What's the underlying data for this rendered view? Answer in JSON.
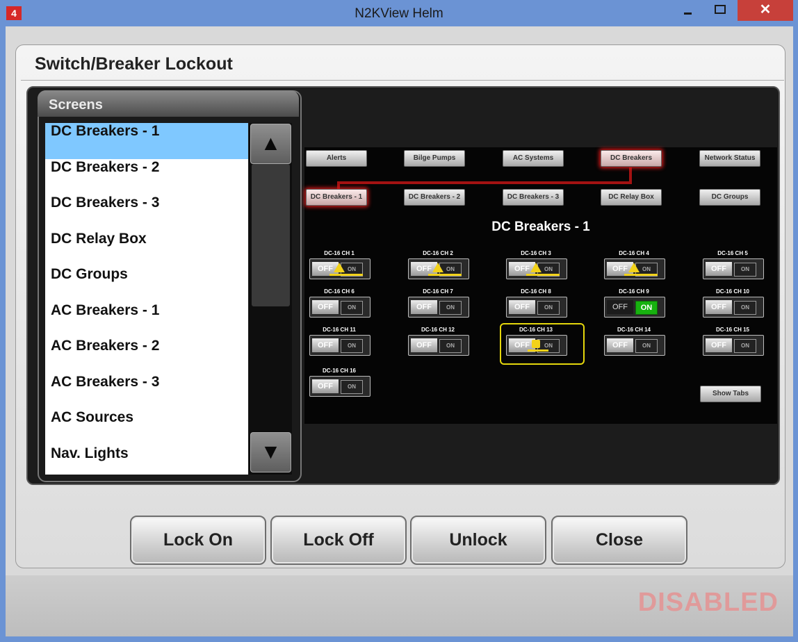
{
  "window": {
    "title": "N2KView Helm",
    "app_icon": "4",
    "close_glyph": "✕"
  },
  "dialog": {
    "title": "Switch/Breaker Lockout"
  },
  "screens": {
    "title": "Screens",
    "items": [
      "DC Breakers - 1",
      "DC Breakers - 2",
      "DC Breakers - 3",
      "DC Relay Box",
      "DC Groups",
      "AC Breakers - 1",
      "AC Breakers - 2",
      "AC Breakers - 3",
      "AC Sources",
      "Nav. Lights"
    ],
    "selected": "DC Breakers - 1",
    "scroll_up": "▲",
    "scroll_down": "▼"
  },
  "preview": {
    "top_nav": [
      "Alerts",
      "Bilge Pumps",
      "AC Systems",
      "DC Breakers",
      "Network Status"
    ],
    "sub_nav": [
      "DC Breakers - 1",
      "DC Breakers - 2",
      "DC Breakers - 3",
      "DC Relay Box",
      "DC Groups"
    ],
    "heading": "DC Breakers - 1",
    "channels": [
      {
        "label": "DC-16 CH 1",
        "state": "off",
        "badge": "warning"
      },
      {
        "label": "DC-16 CH 2",
        "state": "off",
        "badge": "warning"
      },
      {
        "label": "DC-16 CH 3",
        "state": "off",
        "badge": "warning"
      },
      {
        "label": "DC-16 CH 4",
        "state": "off",
        "badge": "warning"
      },
      {
        "label": "DC-16 CH 5",
        "state": "off",
        "badge": "none"
      },
      {
        "label": "DC-16 CH 6",
        "state": "off",
        "badge": "none"
      },
      {
        "label": "DC-16 CH 7",
        "state": "off",
        "badge": "none"
      },
      {
        "label": "DC-16 CH 8",
        "state": "off",
        "badge": "none"
      },
      {
        "label": "DC-16 CH 9",
        "state": "on",
        "badge": "none"
      },
      {
        "label": "DC-16 CH 10",
        "state": "off",
        "badge": "none"
      },
      {
        "label": "DC-16 CH 11",
        "state": "off",
        "badge": "none"
      },
      {
        "label": "DC-16 CH 12",
        "state": "off",
        "badge": "none"
      },
      {
        "label": "DC-16 CH 13",
        "state": "off",
        "badge": "lock",
        "selected": true
      },
      {
        "label": "DC-16 CH 14",
        "state": "off",
        "badge": "none"
      },
      {
        "label": "DC-16 CH 15",
        "state": "off",
        "badge": "none"
      },
      {
        "label": "DC-16 CH 16",
        "state": "off",
        "badge": "none"
      }
    ],
    "off_label": "OFF",
    "on_label": "ON",
    "show_tabs": "Show Tabs"
  },
  "buttons": {
    "lock_on": "Lock On",
    "lock_off": "Lock Off",
    "unlock": "Unlock",
    "close": "Close"
  },
  "status": {
    "text": "DISABLED"
  },
  "colors": {
    "selection": "#7fc8ff",
    "active_tab_glow": "#d21a1a",
    "on_green": "#17b20f",
    "warning_yellow": "#f2d21a",
    "disabled_text": "#e09a9a"
  }
}
